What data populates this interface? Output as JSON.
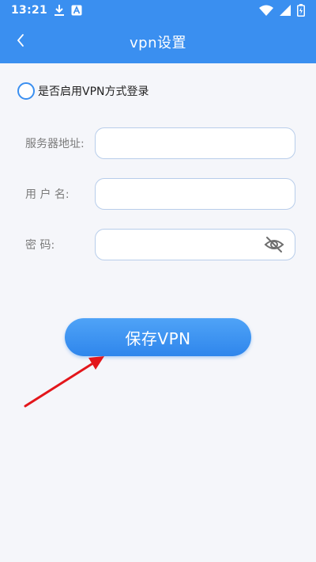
{
  "status_bar": {
    "time": "13:21",
    "icons": [
      "download-icon",
      "a-notification-icon",
      "wifi-icon",
      "signal-icon",
      "battery-icon"
    ]
  },
  "header": {
    "title": "vpn设置",
    "back_icon": "chevron-left-icon"
  },
  "vpn_toggle": {
    "label": "是否启用VPN方式登录",
    "checked": false
  },
  "form": {
    "server": {
      "label": "服务器地址:",
      "value": "",
      "placeholder": ""
    },
    "username": {
      "label": "用 户 名:",
      "value": "",
      "placeholder": ""
    },
    "password": {
      "label": "密 码:",
      "value": "",
      "placeholder": "",
      "visibility_icon": "eye-off-icon"
    }
  },
  "save_button": {
    "label": "保存VPN"
  },
  "annotation": {
    "icon": "red-arrow-icon",
    "color": "#e3161b"
  },
  "colors": {
    "primary": "#3a8ff0",
    "field_border": "#b8cdea",
    "background": "#f5f6fa"
  }
}
